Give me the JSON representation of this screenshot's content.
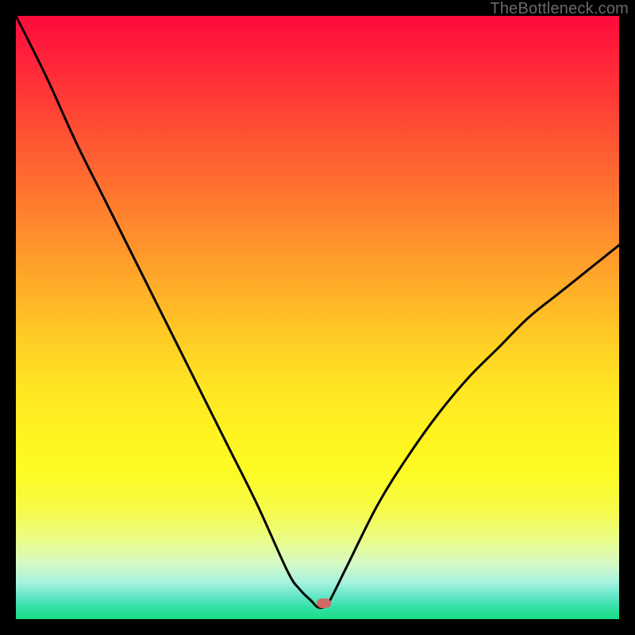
{
  "watermark": "TheBottleneck.com",
  "marker": {
    "x_frac": 0.51,
    "y_frac": 0.974,
    "color": "#d06a64"
  },
  "chart_data": {
    "type": "line",
    "title": "",
    "xlabel": "",
    "ylabel": "",
    "xlim": [
      0,
      100
    ],
    "ylim": [
      0,
      100
    ],
    "grid": false,
    "legend": false,
    "series": [
      {
        "name": "bottleneck-curve",
        "color": "#000000",
        "x": [
          0,
          5,
          10,
          15,
          20,
          25,
          30,
          35,
          40,
          45,
          47,
          49,
          50,
          51,
          52,
          55,
          60,
          65,
          70,
          75,
          80,
          85,
          90,
          95,
          100
        ],
        "y": [
          100,
          90,
          79,
          69,
          59,
          49,
          39,
          29,
          19,
          8,
          5,
          3,
          2,
          2,
          3,
          9,
          19,
          27,
          34,
          40,
          45,
          50,
          54,
          58,
          62
        ]
      }
    ],
    "annotations": [
      {
        "type": "marker",
        "x": 51,
        "y": 2.6,
        "shape": "rounded-rect",
        "color": "#d06a64"
      }
    ]
  }
}
